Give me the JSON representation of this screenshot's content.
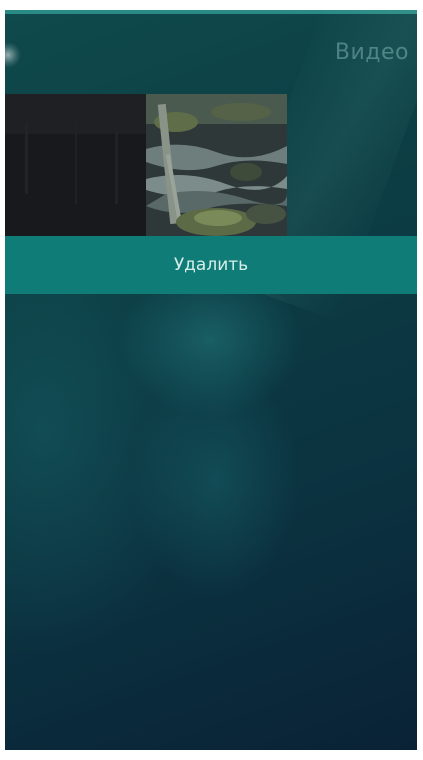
{
  "header": {
    "title": "Видео",
    "pulley_icon": "pulley-menu-indicator"
  },
  "videos": [
    {
      "id": "video-dark"
    },
    {
      "id": "video-nature"
    }
  ],
  "context_menu": {
    "delete_label": "Удалить"
  },
  "colors": {
    "accent": "#0f7c78",
    "title": "#7fb5b5",
    "background": "#0c3d44"
  }
}
